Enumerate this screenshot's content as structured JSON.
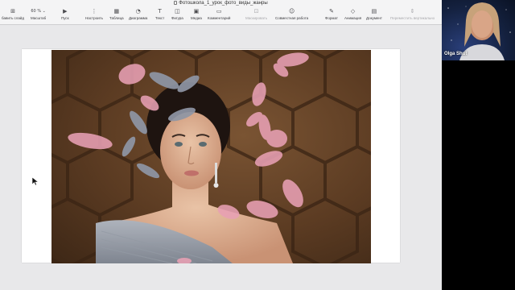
{
  "window": {
    "title": "Фотошкола_1_урок_фото_виды_жанры"
  },
  "toolbar": {
    "items": [
      {
        "label": "бавить слайд",
        "icon": "add-slide-icon"
      },
      {
        "label": "60 %",
        "icon": "zoom-dropdown"
      },
      {
        "label": "Масштаб",
        "icon": ""
      },
      {
        "label": "Пуск",
        "icon": "play-icon"
      },
      {
        "label": "Настроить",
        "icon": "customize-icon"
      },
      {
        "label": "Таблица",
        "icon": "table-icon"
      },
      {
        "label": "Диаграмма",
        "icon": "chart-icon"
      },
      {
        "label": "Текст",
        "icon": "text-icon"
      },
      {
        "label": "Фигура",
        "icon": "shape-icon"
      },
      {
        "label": "Медиа",
        "icon": "media-icon"
      },
      {
        "label": "Комментарий",
        "icon": "comment-icon"
      },
      {
        "label": "Маскировать",
        "icon": "mask-icon",
        "disabled": true
      },
      {
        "label": "Совместная работа",
        "icon": "collaborate-icon"
      },
      {
        "label": "Формат",
        "icon": "format-icon"
      },
      {
        "label": "Анимация",
        "icon": "animate-icon"
      },
      {
        "label": "Документ",
        "icon": "document-icon"
      },
      {
        "label": "Переместить вертикально",
        "icon": "move-icon",
        "disabled": true
      }
    ]
  },
  "video": {
    "participant_name": "Olga Shut"
  },
  "colors": {
    "accent": "#e8a0b4",
    "window_bg": "#e7e7e9",
    "toolbar_bg": "#f4f4f5"
  }
}
